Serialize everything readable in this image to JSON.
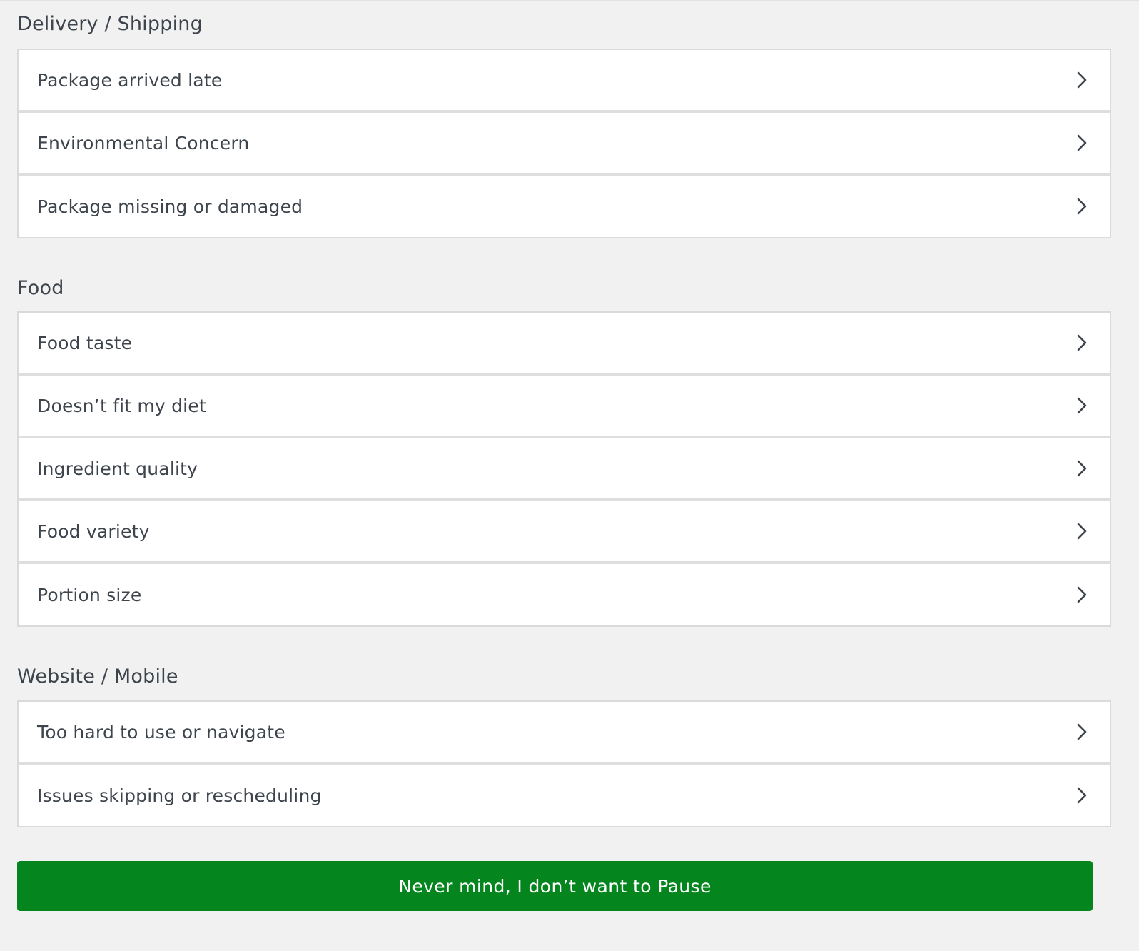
{
  "sections": [
    {
      "title": "Delivery / Shipping",
      "items": [
        {
          "label": "Package arrived late"
        },
        {
          "label": "Environmental Concern"
        },
        {
          "label": "Package missing or damaged"
        }
      ]
    },
    {
      "title": "Food",
      "items": [
        {
          "label": "Food taste"
        },
        {
          "label": "Doesn’t fit my diet"
        },
        {
          "label": "Ingredient quality"
        },
        {
          "label": "Food variety"
        },
        {
          "label": "Portion size"
        }
      ]
    },
    {
      "title": "Website / Mobile",
      "items": [
        {
          "label": "Too hard to use or navigate"
        },
        {
          "label": "Issues skipping or rescheduling"
        }
      ]
    }
  ],
  "cta": {
    "label": "Never mind, I don’t want to Pause",
    "color": "#04851d"
  },
  "icons": {
    "row_chevron": "chevron-right-icon"
  },
  "colors": {
    "background": "#f1f1f1",
    "card": "#ffffff",
    "text": "#3d444c",
    "divider": "#dedede"
  }
}
